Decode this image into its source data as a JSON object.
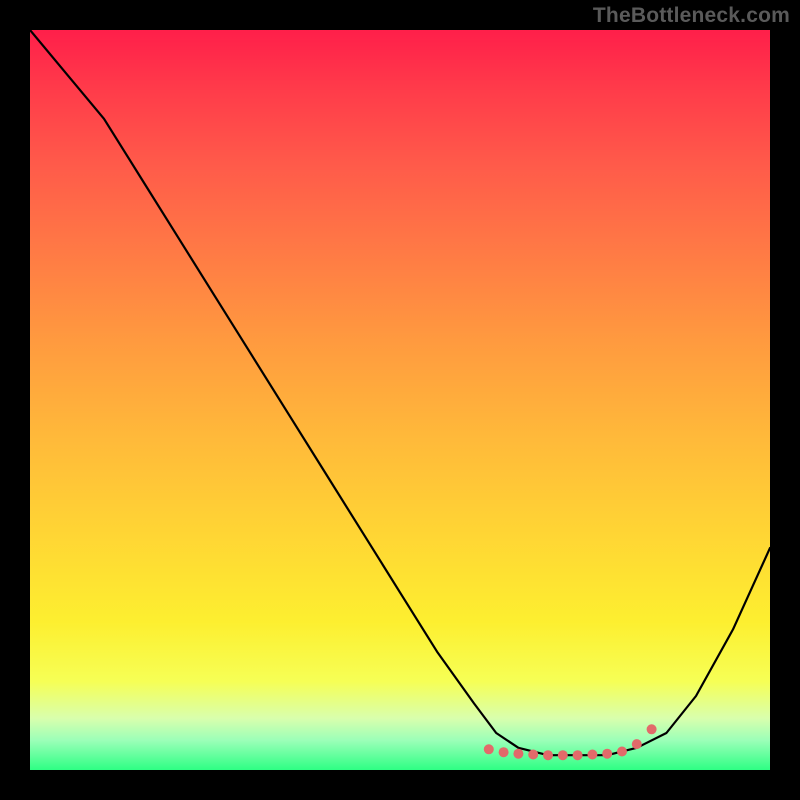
{
  "watermark": "TheBottleneck.com",
  "chart_data": {
    "type": "line",
    "title": "",
    "xlabel": "",
    "ylabel": "",
    "xlim": [
      0,
      100
    ],
    "ylim": [
      0,
      100
    ],
    "grid": false,
    "series": [
      {
        "name": "curve",
        "x": [
          0,
          5,
          10,
          15,
          20,
          25,
          30,
          35,
          40,
          45,
          50,
          55,
          60,
          63,
          66,
          70,
          74,
          78,
          82,
          86,
          90,
          95,
          100
        ],
        "y": [
          100,
          94,
          88,
          80,
          72,
          64,
          56,
          48,
          40,
          32,
          24,
          16,
          9,
          5,
          3,
          2,
          2,
          2,
          3,
          5,
          10,
          19,
          30
        ]
      }
    ],
    "markers": {
      "name": "trough-dots",
      "color": "#e26a6a",
      "x": [
        62,
        64,
        66,
        68,
        70,
        72,
        74,
        76,
        78,
        80,
        82,
        84
      ],
      "y": [
        2.8,
        2.4,
        2.2,
        2.1,
        2.0,
        2.0,
        2.0,
        2.1,
        2.2,
        2.5,
        3.5,
        5.5
      ]
    },
    "background_gradient": {
      "top": "#ff1f4a",
      "mid": "#ffd534",
      "bottom": "#2eff84"
    }
  }
}
